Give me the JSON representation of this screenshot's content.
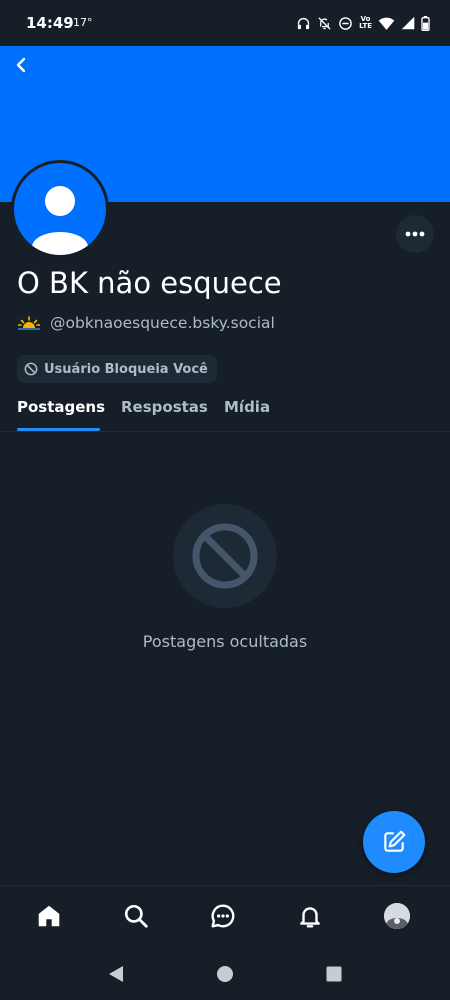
{
  "status_bar": {
    "time": "14:49",
    "temperature": "17°",
    "network_label_top": "Vo",
    "network_label_bottom": "LTE"
  },
  "profile": {
    "display_name": "O BK não esquece",
    "handle": "@obknaoesquece.bsky.social",
    "handle_emoji": "sunrise-emoji",
    "blocked_badge": "Usuário Bloqueia Você",
    "banner_color": "#0070ff",
    "avatar_color": "#0070ff"
  },
  "tabs": [
    {
      "label": "Postagens",
      "active": true
    },
    {
      "label": "Respostas",
      "active": false
    },
    {
      "label": "Mídia",
      "active": false
    }
  ],
  "empty_state": {
    "icon": "block-icon",
    "message": "Postagens ocultadas"
  },
  "bottom_nav": [
    "home-icon",
    "search-icon",
    "chat-icon",
    "bell-icon",
    "profile-avatar"
  ],
  "colors": {
    "background": "#161e27",
    "accent": "#208bfe",
    "muted_text": "#aebbc9",
    "surface": "#1e2936"
  }
}
